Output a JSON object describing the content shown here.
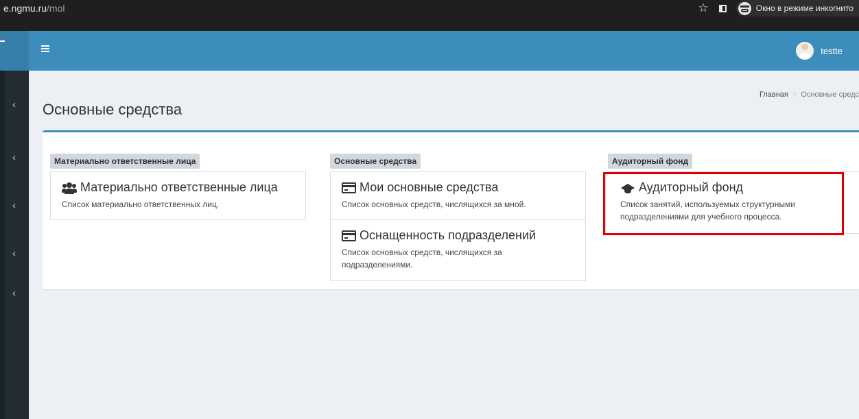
{
  "browser": {
    "url_domain": "e.ngmu.ru",
    "url_path": "/mol",
    "incognito_label": "Окно в режиме инкогнито"
  },
  "header": {
    "username": "testte"
  },
  "page": {
    "title": "Основные средства",
    "breadcrumb": {
      "home": "Главная",
      "separator": ">",
      "current": "Основные средс"
    }
  },
  "columns": [
    {
      "label": "Материально ответственные лица",
      "cards": [
        {
          "icon": "users-icon",
          "title": "Материально ответственные лица",
          "description": "Список материально ответственных лиц."
        }
      ]
    },
    {
      "label": "Основные средства",
      "cards": [
        {
          "icon": "credit-card-icon",
          "title": "Мои основные средства",
          "description": "Список основных средств, числящихся за мной."
        },
        {
          "icon": "credit-card-icon",
          "title": "Оснащенность подразделений",
          "description": "Список основных средств, числящихся за подразделениями."
        }
      ]
    },
    {
      "label": "Аудиторный фонд",
      "cards": [
        {
          "icon": "graduation-cap-icon",
          "title": "Аудиторный фонд",
          "description": "Список занятий, используемых структурными подразделениями для учебного процесса."
        }
      ]
    }
  ],
  "colors": {
    "header_blue": "#3c8dbc",
    "sidebar_dark": "#222d32",
    "highlight_red": "#e00000"
  }
}
